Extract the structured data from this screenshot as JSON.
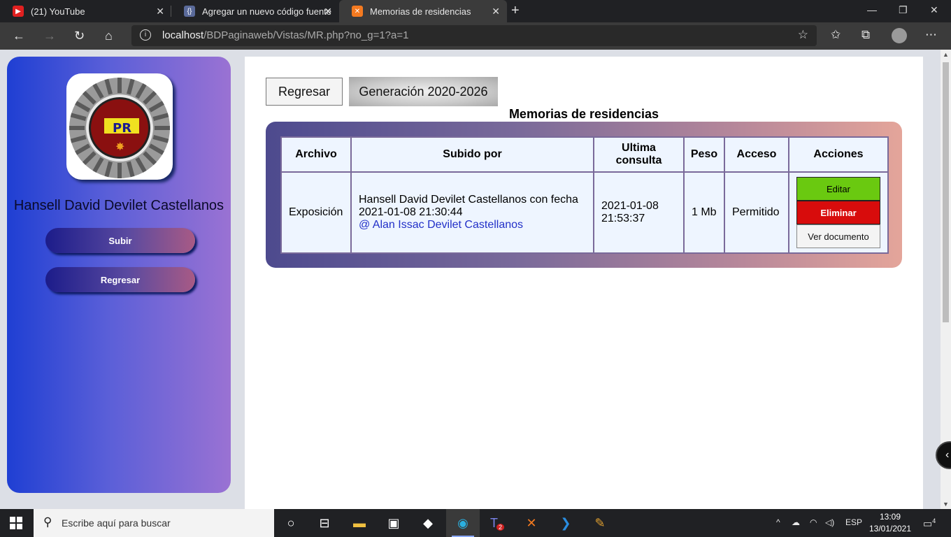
{
  "browser": {
    "tabs": [
      {
        "title": "(21) YouTube",
        "favicon": "youtube-icon"
      },
      {
        "title": "Agregar un nuevo código fuente",
        "favicon": "code-icon"
      },
      {
        "title": "Memorias de residencias",
        "favicon": "xampp-icon",
        "active": true
      }
    ],
    "url_host": "localhost",
    "url_path": "/BDPaginaweb/Vistas/MR.php?no_g=1?a=1"
  },
  "sidebar": {
    "user_name": "Hansell David Devilet Castellanos",
    "buttons": [
      "Subir",
      "Regresar"
    ]
  },
  "main": {
    "back_label": "Regresar",
    "generation": "Generación 2020-2026",
    "title": "Memorias de residencias",
    "table": {
      "headers": [
        "Archivo",
        "Subido por",
        "Ultima consulta",
        "Peso",
        "Acceso",
        "Acciones"
      ],
      "rows": [
        {
          "archivo": "Exposición",
          "subido_por": "Hansell David Devilet Castellanos con fecha 2021-01-08 21:30:44",
          "subido_link": "@ Alan Issac Devilet Castellanos",
          "ultima_consulta": "2021-01-08 21:53:37",
          "peso": "1 Mb",
          "acceso": "Permitido",
          "actions": {
            "edit": "Editar",
            "delete": "Eliminar",
            "view": "Ver documento"
          }
        }
      ]
    }
  },
  "taskbar": {
    "search_placeholder": "Escribe aquí para buscar",
    "language": "ESP",
    "time": "13:09",
    "date": "13/01/2021",
    "notifications": "4",
    "teams_badge": "2"
  },
  "colors": {
    "edit": "#6ac910",
    "delete": "#d80c0c",
    "link": "#2230c8"
  }
}
